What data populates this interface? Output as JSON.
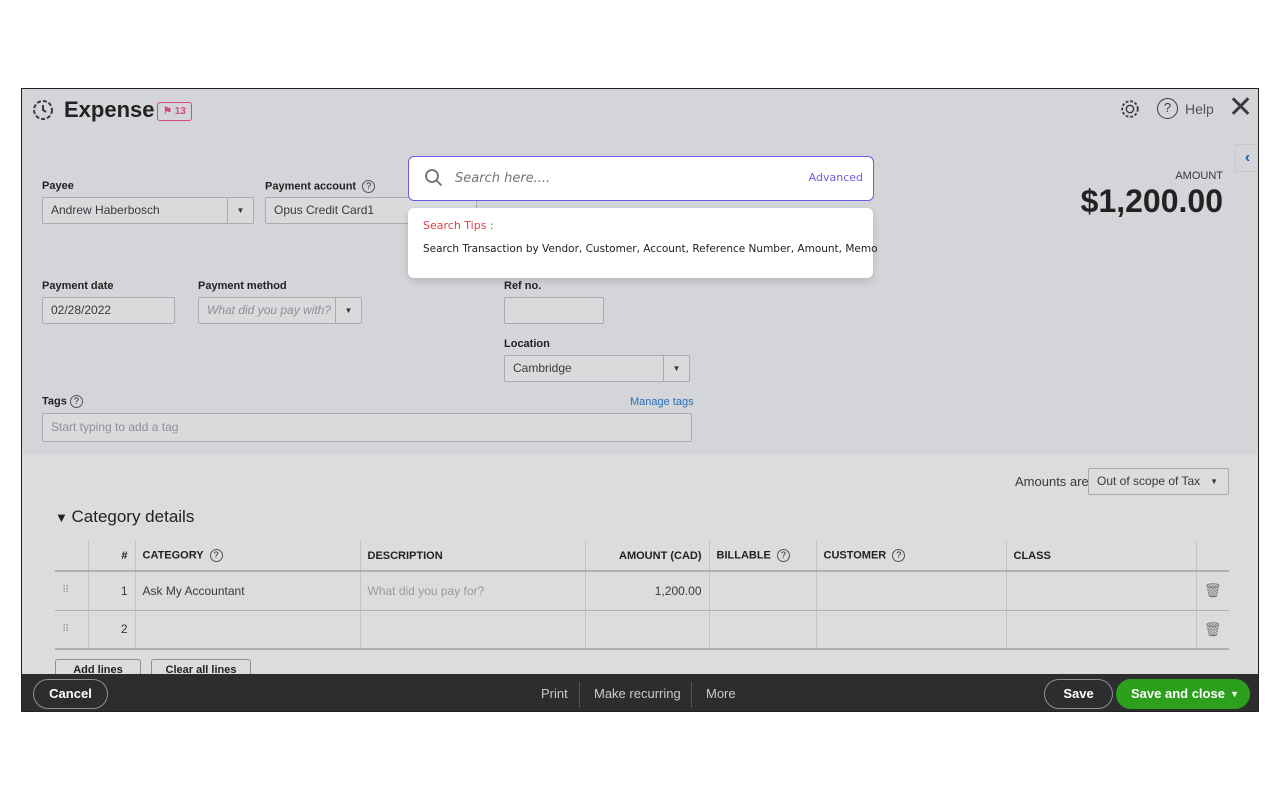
{
  "header": {
    "title": "Expense",
    "badge_count": "13",
    "help_label": "Help",
    "amount_label": "AMOUNT",
    "amount_value": "$1,200.00"
  },
  "search": {
    "placeholder": "Search here....",
    "advanced_label": "Advanced",
    "tips_title": "Search Tips :",
    "tips_text": "Search Transaction by Vendor, Customer, Account, Reference Number, Amount, Memo",
    "accent": "#6b5ce7"
  },
  "form": {
    "payee_label": "Payee",
    "payee_value": "Andrew Haberbosch",
    "payment_account_label": "Payment account",
    "payment_account_value": "Opus Credit Card1",
    "payment_date_label": "Payment date",
    "payment_date_value": "02/28/2022",
    "payment_method_label": "Payment method",
    "payment_method_placeholder": "What did you pay with?",
    "ref_no_label": "Ref no.",
    "ref_no_value": "",
    "location_label": "Location",
    "location_value": "Cambridge",
    "tags_label": "Tags",
    "tags_placeholder": "Start typing to add a tag",
    "manage_tags_label": "Manage tags"
  },
  "amounts_are": {
    "label": "Amounts are",
    "value": "Out of scope of Tax"
  },
  "category": {
    "title": "Category details",
    "columns": [
      "#",
      "CATEGORY",
      "DESCRIPTION",
      "AMOUNT (CAD)",
      "BILLABLE",
      "CUSTOMER",
      "CLASS"
    ],
    "rows": [
      {
        "num": "1",
        "category": "Ask My Accountant",
        "description_placeholder": "What did you pay for?",
        "amount": "1,200.00"
      },
      {
        "num": "2",
        "category": "",
        "description_placeholder": "",
        "amount": ""
      }
    ],
    "add_lines": "Add lines",
    "clear_lines": "Clear all lines"
  },
  "footer": {
    "cancel": "Cancel",
    "print": "Print",
    "make_recurring": "Make recurring",
    "more": "More",
    "save": "Save",
    "save_and_close": "Save and close",
    "green": "#2ca01c"
  }
}
